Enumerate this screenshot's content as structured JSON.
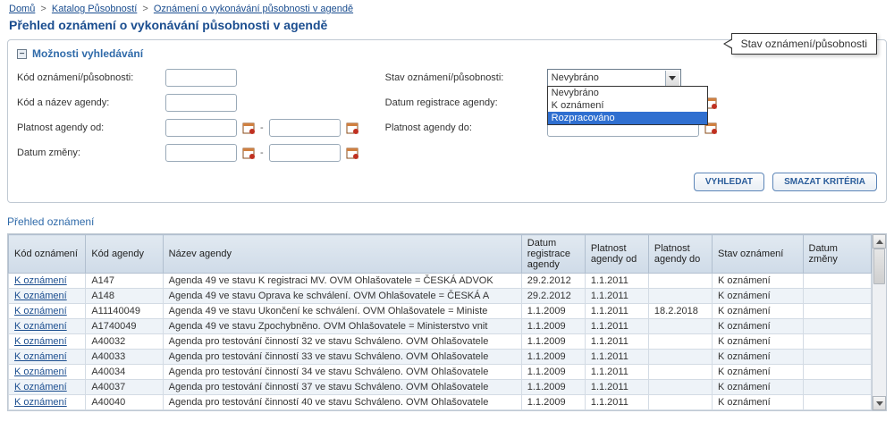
{
  "breadcrumb": {
    "home": "Domů",
    "cat": "Katalog Působností",
    "leaf": "Oznámení o vykonávání působnosti v agendě"
  },
  "page_title": "Přehled oznámení o vykonávání působnosti v agendě",
  "search_panel": {
    "title": "Možnosti vyhledávání",
    "label_kod_oznameni": "Kód oznámení/působnosti:",
    "label_kod_nazev_agendy": "Kód a název agendy:",
    "label_platnost_od": "Platnost agendy od:",
    "label_datum_zmeny": "Datum změny:",
    "label_stav": "Stav oznámení/působnosti:",
    "label_datum_reg": "Datum registrace agendy:",
    "label_platnost_do": "Platnost agendy do:",
    "stav_value": "Nevybráno",
    "stav_options": [
      "Nevybráno",
      "K oznámení",
      "Rozpracováno"
    ],
    "callout": "Stav oznámení/působnosti",
    "btn_search": "VYHLEDAT",
    "btn_clear": "SMAZAT KRITÉRIA"
  },
  "results": {
    "title": "Přehled oznámení",
    "columns": {
      "kod_ozn": "Kód oznámení",
      "kod_ag": "Kód agendy",
      "nazev_ag": "Název agendy",
      "datum_reg": "Datum registrace agendy",
      "plat_od": "Platnost agendy od",
      "plat_do": "Platnost agendy do",
      "stav": "Stav oznámení",
      "datum_zm": "Datum změny"
    },
    "link_label": "K oznámení",
    "rows": [
      {
        "kod_ag": "A147",
        "nazev": "Agenda 49 ve stavu K registraci MV. OVM Ohlašovatele = ČESKÁ ADVOK",
        "reg": "29.2.2012",
        "od": "1.1.2011",
        "do": "",
        "stav": "K oznámení"
      },
      {
        "kod_ag": "A148",
        "nazev": "Agenda 49 ve stavu Oprava ke schválení. OVM Ohlašovatele = ČESKÁ A",
        "reg": "29.2.2012",
        "od": "1.1.2011",
        "do": "",
        "stav": "K oznámení"
      },
      {
        "kod_ag": "A11140049",
        "nazev": "Agenda 49 ve stavu Ukončení ke schválení. OVM Ohlašovatele = Ministe",
        "reg": "1.1.2009",
        "od": "1.1.2011",
        "do": "18.2.2018",
        "stav": "K oznámení"
      },
      {
        "kod_ag": "A1740049",
        "nazev": "Agenda 49 ve stavu Zpochybněno. OVM Ohlašovatele = Ministerstvo vnit",
        "reg": "1.1.2009",
        "od": "1.1.2011",
        "do": "",
        "stav": "K oznámení"
      },
      {
        "kod_ag": "A40032",
        "nazev": "Agenda pro testování činností 32 ve stavu Schváleno. OVM Ohlašovatele",
        "reg": "1.1.2009",
        "od": "1.1.2011",
        "do": "",
        "stav": "K oznámení"
      },
      {
        "kod_ag": "A40033",
        "nazev": "Agenda pro testování činností 33 ve stavu Schváleno. OVM Ohlašovatele",
        "reg": "1.1.2009",
        "od": "1.1.2011",
        "do": "",
        "stav": "K oznámení"
      },
      {
        "kod_ag": "A40034",
        "nazev": "Agenda pro testování činností 34 ve stavu Schváleno. OVM Ohlašovatele",
        "reg": "1.1.2009",
        "od": "1.1.2011",
        "do": "",
        "stav": "K oznámení"
      },
      {
        "kod_ag": "A40037",
        "nazev": "Agenda pro testování činností 37 ve stavu Schváleno. OVM Ohlašovatele",
        "reg": "1.1.2009",
        "od": "1.1.2011",
        "do": "",
        "stav": "K oznámení"
      },
      {
        "kod_ag": "A40040",
        "nazev": "Agenda pro testování činností 40 ve stavu Schváleno. OVM Ohlašovatele",
        "reg": "1.1.2009",
        "od": "1.1.2011",
        "do": "",
        "stav": "K oznámení"
      }
    ]
  }
}
